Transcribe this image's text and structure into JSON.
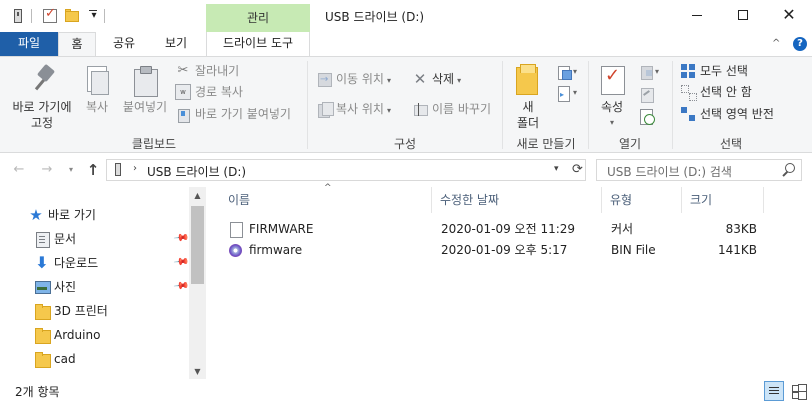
{
  "titlebar": {
    "window_title": "USB 드라이브 (D:)",
    "context_tab_label": "관리",
    "minimize_label": "",
    "maximize_label": "",
    "close_label": "✕",
    "quick_access_dropdown": "▾"
  },
  "tabs": {
    "file": "파일",
    "home": "홈",
    "share": "공유",
    "view": "보기",
    "drive_tools": "드라이브 도구",
    "collapse": "^",
    "help": "?"
  },
  "ribbon": {
    "clipboard": {
      "pin_label": "바로 가기에\n고정",
      "copy_label": "복사",
      "paste_label": "붙여넣기",
      "cut_label": "잘라내기",
      "copy_path_label": "경로 복사",
      "paste_shortcut_label": "바로 가기 붙여넣기",
      "group_label": "클립보드"
    },
    "organize": {
      "move_to_label": "이동 위치",
      "delete_label": "삭제",
      "copy_to_label": "복사 위치",
      "rename_label": "이름 바꾸기",
      "group_label": "구성"
    },
    "new": {
      "new_folder_label": "새\n폴더",
      "group_label": "새로 만들기"
    },
    "open": {
      "properties_label": "속성",
      "group_label": "열기"
    },
    "select": {
      "select_all_label": "모두 선택",
      "select_none_label": "선택 안 함",
      "invert_label": "선택 영역 반전",
      "group_label": "선택"
    }
  },
  "navigation": {
    "back": "←",
    "forward": "→",
    "recent": "▾",
    "up": "↑",
    "address_chevron": "›",
    "address_path": "USB 드라이브 (D:)",
    "address_dropdown": "▾",
    "refresh": "⟳",
    "search_placeholder": "USB 드라이브 (D:) 검색"
  },
  "nav_pane": {
    "quick_access": "바로 가기",
    "items": [
      {
        "label": "문서",
        "pinned": true
      },
      {
        "label": "다운로드",
        "pinned": true
      },
      {
        "label": "사진",
        "pinned": true
      },
      {
        "label": "3D 프린터",
        "pinned": false
      },
      {
        "label": "Arduino",
        "pinned": false
      },
      {
        "label": "cad",
        "pinned": false
      }
    ],
    "pin_glyph": "📌"
  },
  "file_list": {
    "columns": [
      "이름",
      "수정한 날짜",
      "유형",
      "크기"
    ],
    "sort_indicator": "^",
    "rows": [
      {
        "name": "FIRMWARE",
        "date": "2020-01-09 오전 11:29",
        "type": "커서",
        "size": "83KB",
        "icon": "blank-file-icon"
      },
      {
        "name": "firmware",
        "date": "2020-01-09 오후 5:17",
        "type": "BIN File",
        "size": "141KB",
        "icon": "bin-file-icon"
      }
    ]
  },
  "statusbar": {
    "item_count": "2개 항목"
  }
}
